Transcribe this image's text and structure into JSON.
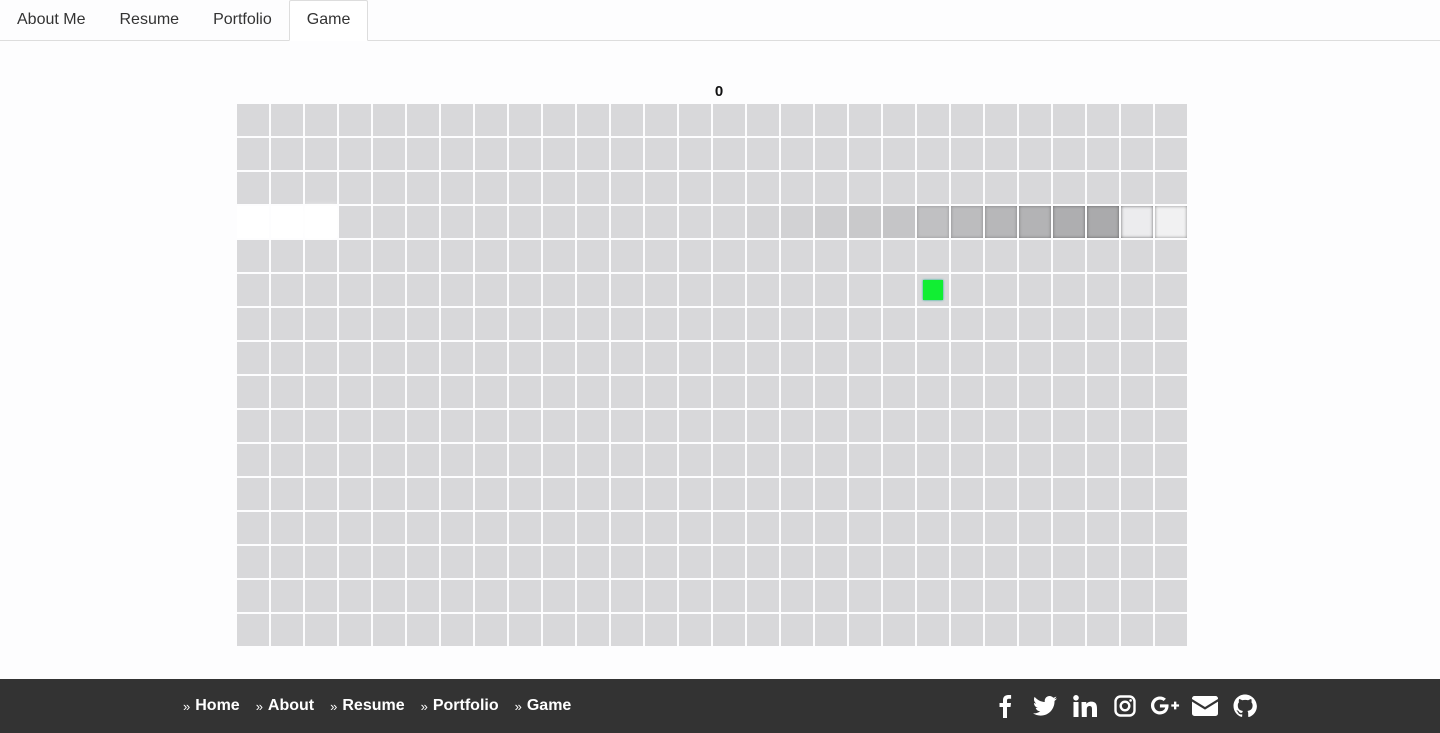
{
  "tabs": [
    "About Me",
    "Resume",
    "Portfolio",
    "Game"
  ],
  "active_tab": "Game",
  "score": "0",
  "board": {
    "columns": 28,
    "rows": 16,
    "food": {
      "col": 20,
      "row": 5
    },
    "snake_row": 3,
    "trail_alpha_by_col": [
      0.35,
      0.45,
      0.7,
      0,
      0,
      0,
      0,
      0,
      0,
      0,
      0,
      0,
      0,
      0,
      0,
      0.02,
      0.04,
      0.07,
      0.1,
      0.13,
      0.16,
      0.19,
      0.22,
      0.25,
      0.28,
      0.31,
      0.4,
      0.3
    ]
  },
  "colors": {
    "cell": "#d8d8da",
    "food": "#11ee33",
    "footer": "#333333"
  },
  "footer": {
    "links": [
      "Home",
      "About",
      "Resume",
      "Portfolio",
      "Game"
    ],
    "social": [
      "facebook-icon",
      "twitter-icon",
      "linkedin-icon",
      "instagram-icon",
      "google-plus-icon",
      "envelope-icon",
      "github-icon"
    ]
  }
}
